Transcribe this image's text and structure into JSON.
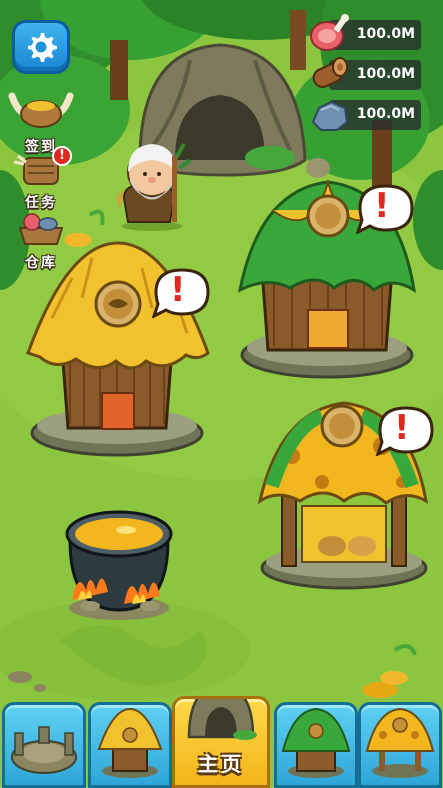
{
  "resources": [
    {
      "icon": "meat-icon",
      "value": "100.0M"
    },
    {
      "icon": "wood-log-icon",
      "value": "100.0M"
    },
    {
      "icon": "stone-icon",
      "value": "100.0M"
    }
  ],
  "side_menu": {
    "checkin_label": "签到",
    "tasks_label": "任务",
    "warehouse_label": "仓库"
  },
  "bottom_nav": {
    "home_label": "主页"
  },
  "alert_mark": "!",
  "colors": {
    "grass": "#8cc63f",
    "nav_blue": "#2ea6d8",
    "nav_active": "#f2b51a",
    "alert_red": "#e0281e"
  }
}
